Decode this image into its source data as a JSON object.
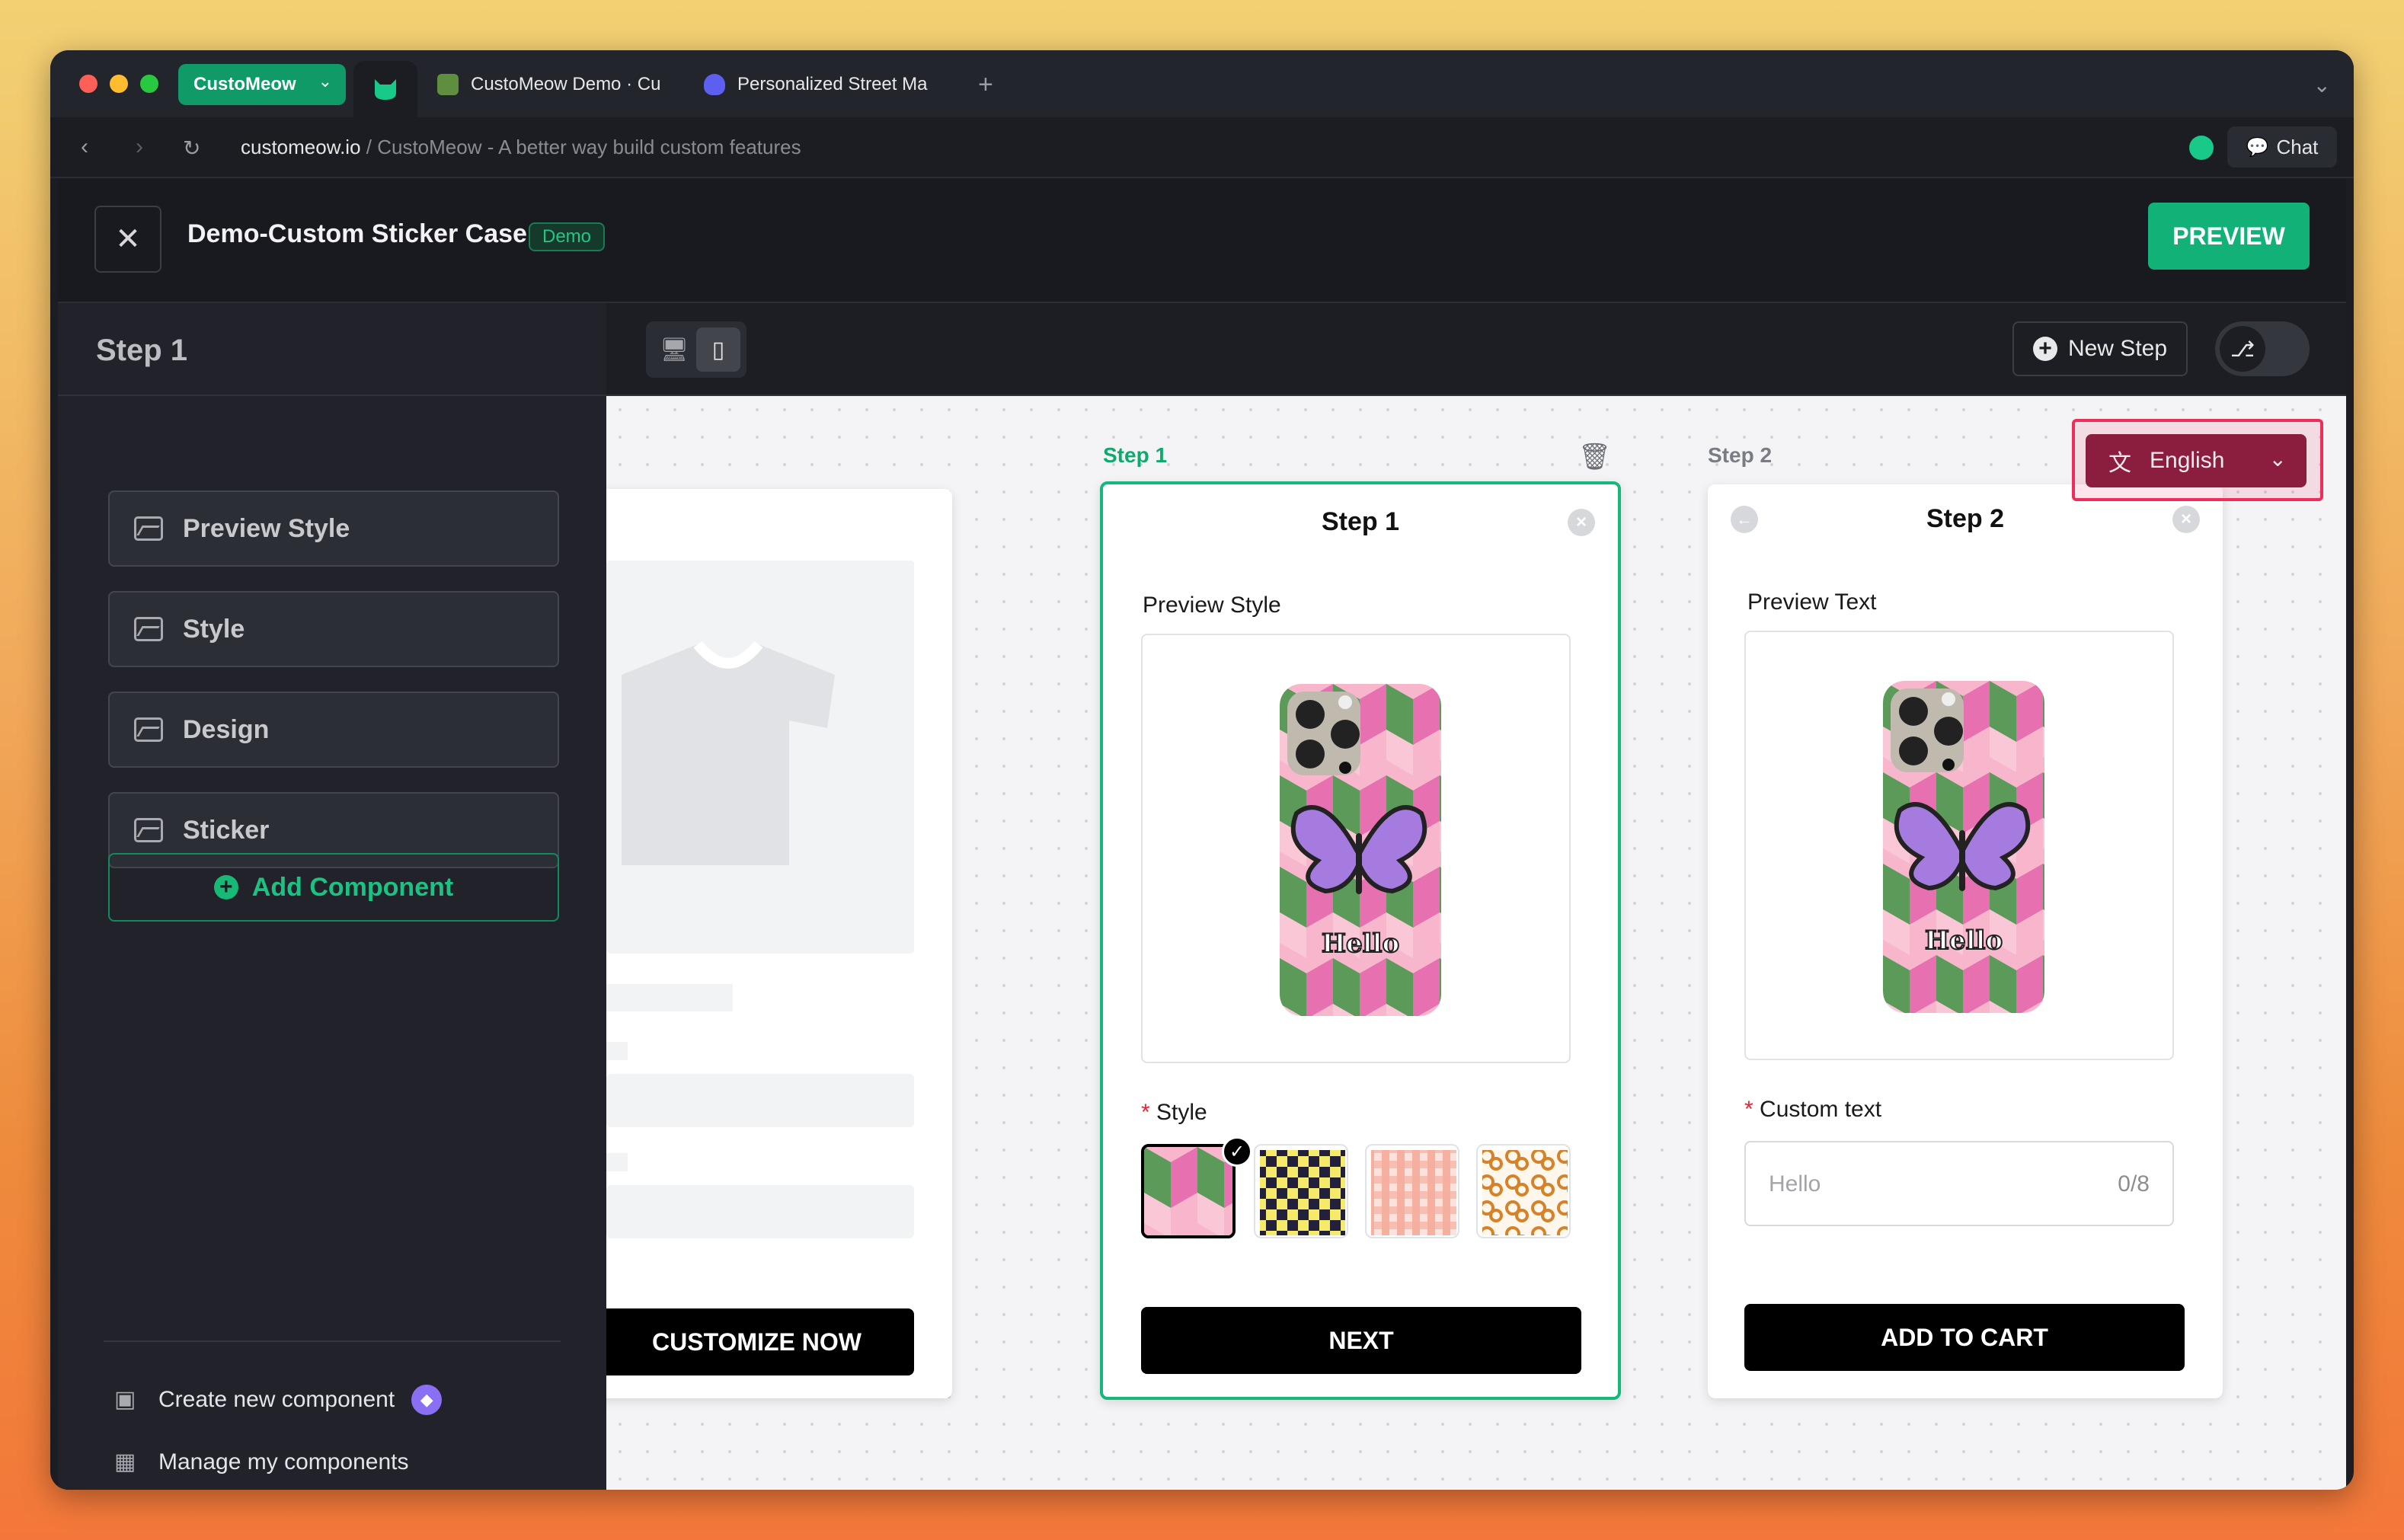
{
  "browser": {
    "tab_group_label": "CustoMeow",
    "tabs": [
      {
        "label": "CustoMeow Demo · Cu"
      },
      {
        "label": "Personalized Street Ma"
      }
    ],
    "url_domain": "customeow.io",
    "url_path": " / CustoMeow - A better way build custom features",
    "chat_label": "Chat"
  },
  "header": {
    "title": "Demo-Custom Sticker Case",
    "badge": "Demo",
    "preview_label": "PREVIEW"
  },
  "sidebar": {
    "title": "Step 1",
    "components": [
      {
        "label": "Preview Style"
      },
      {
        "label": "Style"
      },
      {
        "label": "Design"
      },
      {
        "label": "Sticker"
      }
    ],
    "add_component_label": "Add Component",
    "footer": [
      {
        "label": "Create new component"
      },
      {
        "label": "Manage my components"
      }
    ]
  },
  "toolbar": {
    "new_step_label": "New Step"
  },
  "canvas": {
    "product_card": {
      "cta_label": "CUSTOMIZE NOW"
    },
    "step1": {
      "step_label": "Step 1",
      "title": "Step 1",
      "preview_label": "Preview Style",
      "phone_text": "Hello",
      "style_label": "Style",
      "cta_label": "NEXT"
    },
    "step2": {
      "step_label": "Step 2",
      "title": "Step 2",
      "preview_label": "Preview Text",
      "phone_text": "Hello",
      "custom_text_label": "Custom text",
      "input_placeholder": "Hello",
      "char_count": "0/8",
      "cta_label": "ADD TO CART"
    },
    "language": {
      "selected": "English"
    }
  },
  "colors": {
    "accent": "#12b178",
    "highlight": "#ee2d5a",
    "lang_bg": "#8b1e3f"
  }
}
